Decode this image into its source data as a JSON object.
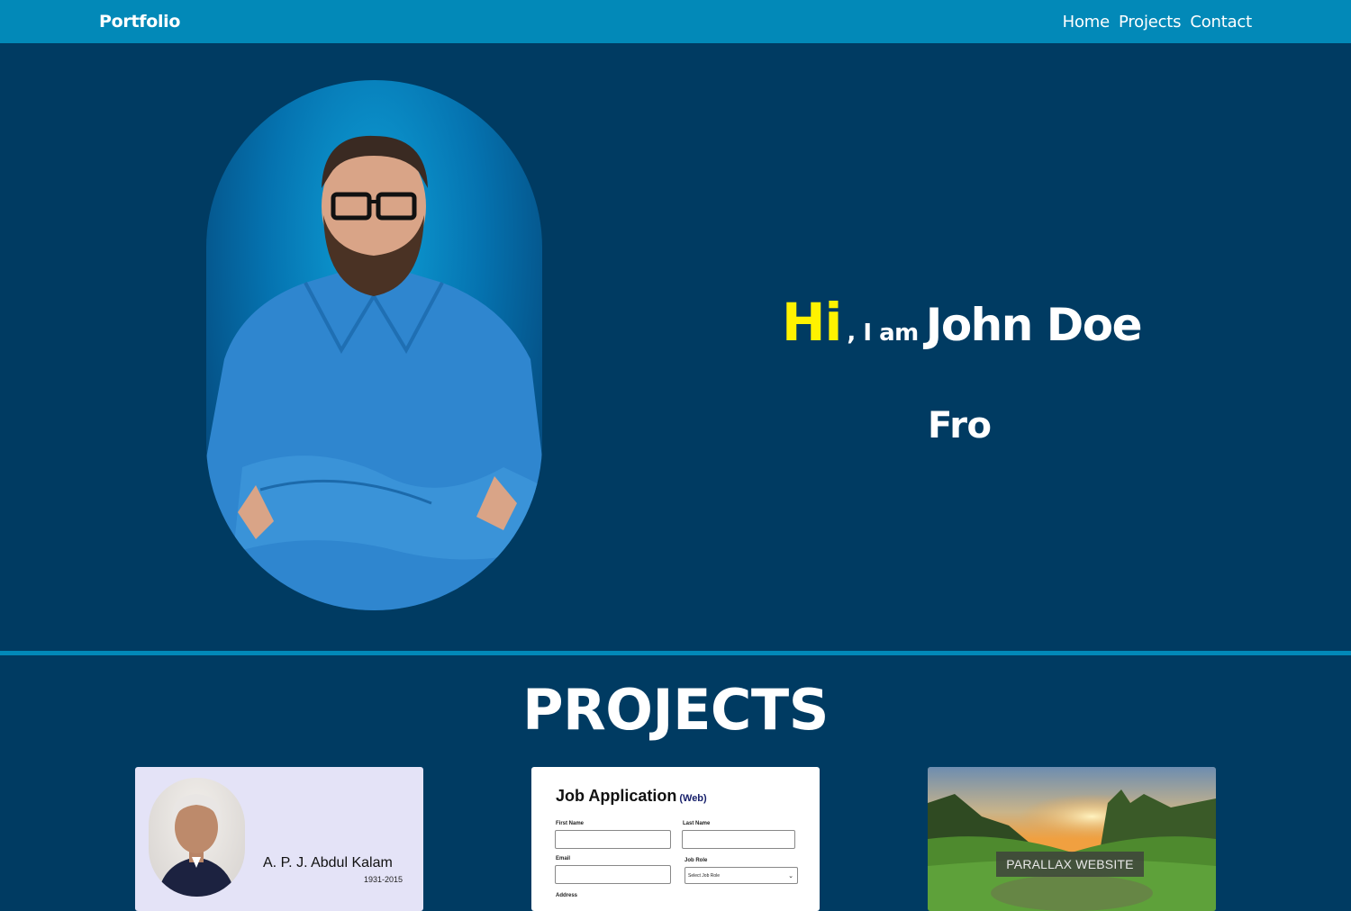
{
  "nav": {
    "brand": "Portfolio",
    "links": [
      "Home",
      "Projects",
      "Contact"
    ]
  },
  "hero": {
    "greeting": "Hi",
    "intro": ", I am",
    "name": "John Doe",
    "role_typed": "Fro",
    "accent_color": "#fff200"
  },
  "projects": {
    "title": "PROJECTS",
    "cards": [
      {
        "name": "A. P. J. Abdul Kalam",
        "years": "1931-2015"
      },
      {
        "title": "Job Application",
        "subtitle": "(Web)",
        "fields": {
          "first_name": "First Name",
          "last_name": "Last Name",
          "email": "Email",
          "job_role": "Job Role",
          "job_role_value": "Select Job Role",
          "address": "Address"
        }
      },
      {
        "label": "PARALLAX WEBSITE"
      }
    ]
  },
  "colors": {
    "navbar": "#0289b8",
    "background": "#003b62",
    "divider": "#0289b8"
  }
}
